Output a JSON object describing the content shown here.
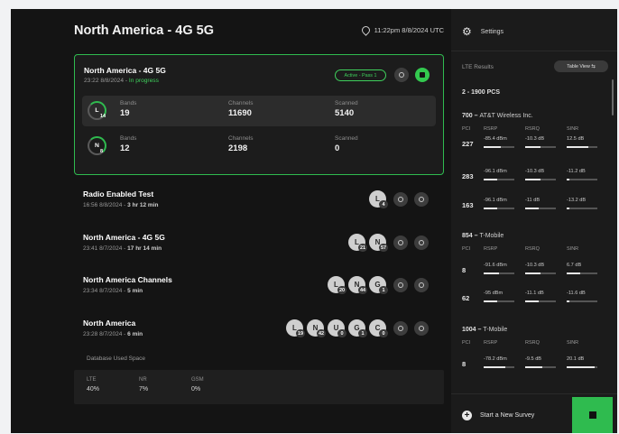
{
  "header": {
    "title": "North America - 4G 5G",
    "time": "11:22pm 8/8/2024 UTC"
  },
  "active": {
    "title": "North America - 4G 5G",
    "date": "23:22 8/8/2024 -",
    "status": "In progress",
    "pass_badge": "Active - Pass 1",
    "rows": [
      {
        "tech": "L",
        "count": "14",
        "bands_label": "Bands",
        "bands": "19",
        "channels_label": "Channels",
        "channels": "11690",
        "scanned_label": "Scanned",
        "scanned": "5140"
      },
      {
        "tech": "N",
        "count": "8",
        "bands_label": "Bands",
        "bands": "12",
        "channels_label": "Channels",
        "channels": "2198",
        "scanned_label": "Scanned",
        "scanned": "0"
      }
    ]
  },
  "surveys": [
    {
      "title": "Radio Enabled Test",
      "date": "16:56 8/8/2024 -",
      "duration": "3 hr 12 min",
      "techs": [
        {
          "t": "L",
          "n": "4"
        }
      ]
    },
    {
      "title": "North America - 4G 5G",
      "date": "23:41 8/7/2024 -",
      "duration": "17 hr 14 min",
      "techs": [
        {
          "t": "L",
          "n": "21"
        },
        {
          "t": "N",
          "n": "57"
        }
      ]
    },
    {
      "title": "North America Channels",
      "date": "23:34 8/7/2024 -",
      "duration": "5 min",
      "techs": [
        {
          "t": "L",
          "n": "20"
        },
        {
          "t": "N",
          "n": "44"
        },
        {
          "t": "G",
          "n": "1"
        }
      ]
    },
    {
      "title": "North America",
      "date": "23:28 8/7/2024 -",
      "duration": "6 min",
      "techs": [
        {
          "t": "L",
          "n": "19"
        },
        {
          "t": "N",
          "n": "42"
        },
        {
          "t": "U",
          "n": "0"
        },
        {
          "t": "G",
          "n": "1"
        },
        {
          "t": "C",
          "n": "0"
        }
      ]
    }
  ],
  "database": {
    "label": "Database Used Space",
    "cols": [
      {
        "k": "LTE",
        "v": "40%"
      },
      {
        "k": "NR",
        "v": "7%"
      },
      {
        "k": "GSM",
        "v": "0%"
      }
    ]
  },
  "sidebar": {
    "settings": "Settings",
    "lte_header": "LTE Results",
    "table_view": "Table View",
    "band_title": "2 - 1900 PCS",
    "groups": [
      {
        "band": "700",
        "operator": "AT&T Wireless Inc.",
        "headers": [
          "PCI",
          "RSRP",
          "RSRQ",
          "SINR"
        ],
        "rows": [
          {
            "pci": "227",
            "rsrp": "-85.4 dBm",
            "rsrq": "-10.3 dB",
            "sinr": "12.5 dB",
            "rsrp_fill": 0.55,
            "rsrq_fill": 0.5,
            "sinr_fill": 0.7
          },
          {
            "pci": "283",
            "rsrp": "-96.1 dBm",
            "rsrq": "-10.3 dB",
            "sinr": "-11.2 dB",
            "rsrp_fill": 0.45,
            "rsrq_fill": 0.5,
            "sinr_fill": 0.1
          },
          {
            "pci": "163",
            "rsrp": "-96.1 dBm",
            "rsrq": "-11 dB",
            "sinr": "-13.2 dB",
            "rsrp_fill": 0.45,
            "rsrq_fill": 0.45,
            "sinr_fill": 0.08
          }
        ]
      },
      {
        "band": "854",
        "operator": "T-Mobile",
        "headers": [
          "PCI",
          "RSRP",
          "RSRQ",
          "SINR"
        ],
        "rows": [
          {
            "pci": "8",
            "rsrp": "-91.6 dBm",
            "rsrq": "-10.3 dB",
            "sinr": "6.7 dB",
            "rsrp_fill": 0.5,
            "rsrq_fill": 0.5,
            "sinr_fill": 0.45
          },
          {
            "pci": "62",
            "rsrp": "-95 dBm",
            "rsrq": "-11.1 dB",
            "sinr": "-11.6 dB",
            "rsrp_fill": 0.45,
            "rsrq_fill": 0.45,
            "sinr_fill": 0.1
          }
        ]
      },
      {
        "band": "1004",
        "operator": "T-Mobile",
        "headers": [
          "PCI",
          "RSRP",
          "RSRQ",
          "SINR"
        ],
        "rows": [
          {
            "pci": "8",
            "rsrp": "-78.2 dBm",
            "rsrq": "-9.5 dB",
            "sinr": "20.1 dB",
            "rsrp_fill": 0.7,
            "rsrq_fill": 0.55,
            "sinr_fill": 0.9
          }
        ]
      }
    ],
    "start_survey": "Start a New Survey"
  }
}
